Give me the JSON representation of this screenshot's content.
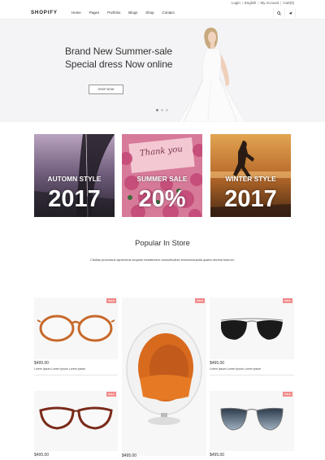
{
  "topbar": {
    "login": "Login",
    "english": "English",
    "my_account": "My Account",
    "cart": "Cart(0)"
  },
  "nav": {
    "logo": "SHOPIFY",
    "items": [
      "Home",
      "Pages",
      "Portfolio",
      "Blogs",
      "Shop",
      "Contact"
    ]
  },
  "hero": {
    "line1": "Brand New Summer-sale",
    "line2": "Special dress Now online",
    "button": "SHOP NOW"
  },
  "promos": [
    {
      "title": "AUTOMN STYLE",
      "big": "2017"
    },
    {
      "title": "SUMMER SALE",
      "big": "20%",
      "script": "Thank you"
    },
    {
      "title": "WINTER STYLE",
      "big": "2017"
    }
  ],
  "popular": {
    "title": "Popular In Store",
    "subtitle": "Claritas processus dynamicus sequitur mutationem consuetudium lectorumauadia quarta decima futurum."
  },
  "products": [
    {
      "badge": "SALE",
      "price": "$495.00",
      "desc": "Lorem Ipsum Lorem Ipsum Lorem Ipsum"
    },
    {
      "badge": "SALE",
      "price": "$495.00",
      "desc": ""
    },
    {
      "badge": "SALE",
      "price": "$495.00",
      "desc": "Lorem Ipsum Lorem Ipsum Lorem Ipsum"
    },
    {
      "badge": "SALE",
      "price": "$495.00",
      "desc": ""
    },
    {
      "badge": "SALE",
      "price": "$495.00",
      "desc": ""
    },
    {
      "badge": "SALE",
      "price": "$495.00",
      "desc": ""
    }
  ],
  "colors": {
    "badge": "#f28b8b",
    "hero_bg": "#f4f4f6",
    "card_bg": "#f7f7f7"
  }
}
